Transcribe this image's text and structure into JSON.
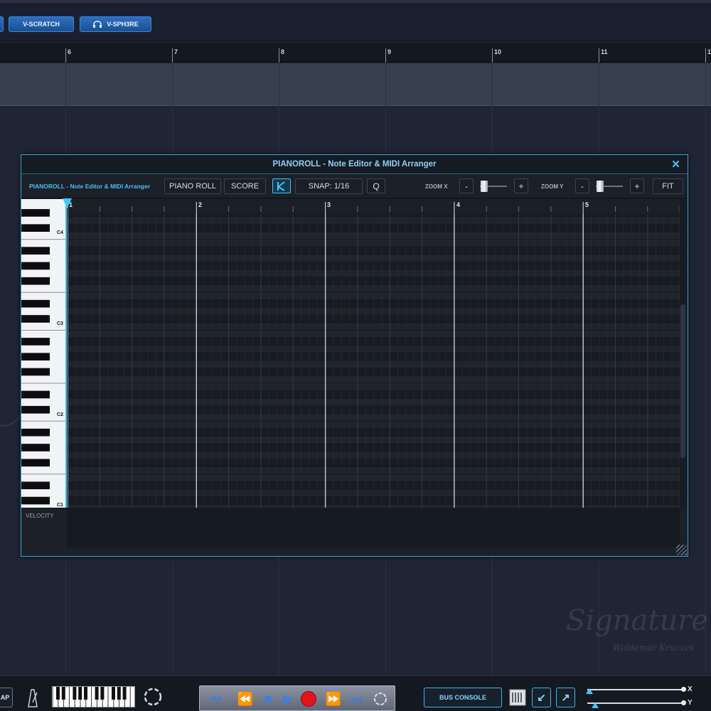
{
  "top_toolbar": {
    "buttons": [
      {
        "label": "V-SCRATCH"
      },
      {
        "label": "V-SPH3RE"
      }
    ]
  },
  "timeline_ruler": {
    "marks": [
      "6",
      "7",
      "8",
      "9",
      "10",
      "11",
      "1"
    ]
  },
  "pianoroll": {
    "title": "PIANOROLL - Note Editor & MIDI Arranger",
    "subtitle": "PIANOROLL - Note Editor & MIDI Arranger",
    "mode_buttons": [
      "PIANO ROLL",
      "SCORE"
    ],
    "snap_label": "SNAP: 1/16",
    "quantize_label": "Q",
    "zoom_x_label": "ZOOM X",
    "zoom_y_label": "ZOOM Y",
    "minus": "-",
    "plus": "+",
    "fit_label": "FIT",
    "bars": [
      "1",
      "2",
      "3",
      "4",
      "5"
    ],
    "octave_labels": [
      "C4",
      "C3",
      "C2",
      "C1"
    ],
    "velocity_label": "VELOCITY",
    "accent_color": "#3ec8ff"
  },
  "bottom_bar": {
    "left_stub": "AP",
    "bus_console_label": "BUS CONSOLE",
    "axis_labels": [
      "X",
      "Y"
    ]
  },
  "watermark": {
    "line1": "Signature",
    "line2": "Waldemar Kruczek"
  }
}
